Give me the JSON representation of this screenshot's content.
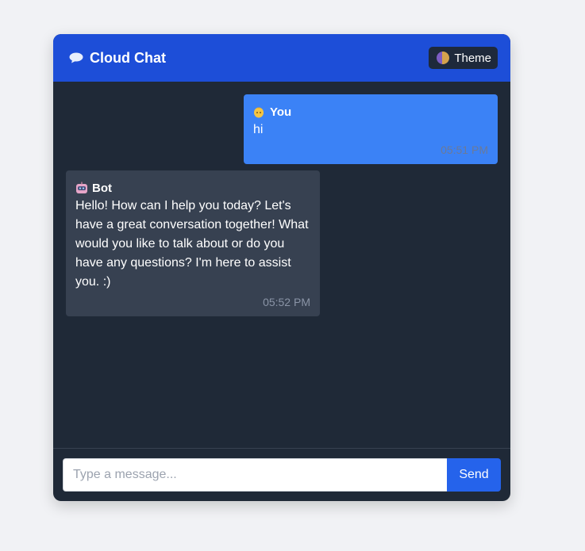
{
  "header": {
    "title": "Cloud Chat",
    "brand_icon": "speech-bubble-icon",
    "theme_label": "Theme",
    "theme_icon": "theme-moon-icon"
  },
  "messages": [
    {
      "sender": "You",
      "avatar_icon": "user-emoji-icon",
      "text": "hi",
      "time": "05:51 PM"
    },
    {
      "sender": "Bot",
      "avatar_icon": "robot-emoji-icon",
      "text": "Hello! How can I help you today? Let's have a great conversation together! What would you like to talk about or do you have any questions? I'm here to assist you. :)",
      "time": "05:52 PM"
    }
  ],
  "composer": {
    "placeholder": "Type a message...",
    "value": "",
    "send_label": "Send"
  },
  "colors": {
    "header": "#1d4ed8",
    "chat_bg": "#1f2937",
    "user_bubble": "#3b82f6",
    "bot_bubble": "#374151",
    "send_button": "#2563eb"
  }
}
